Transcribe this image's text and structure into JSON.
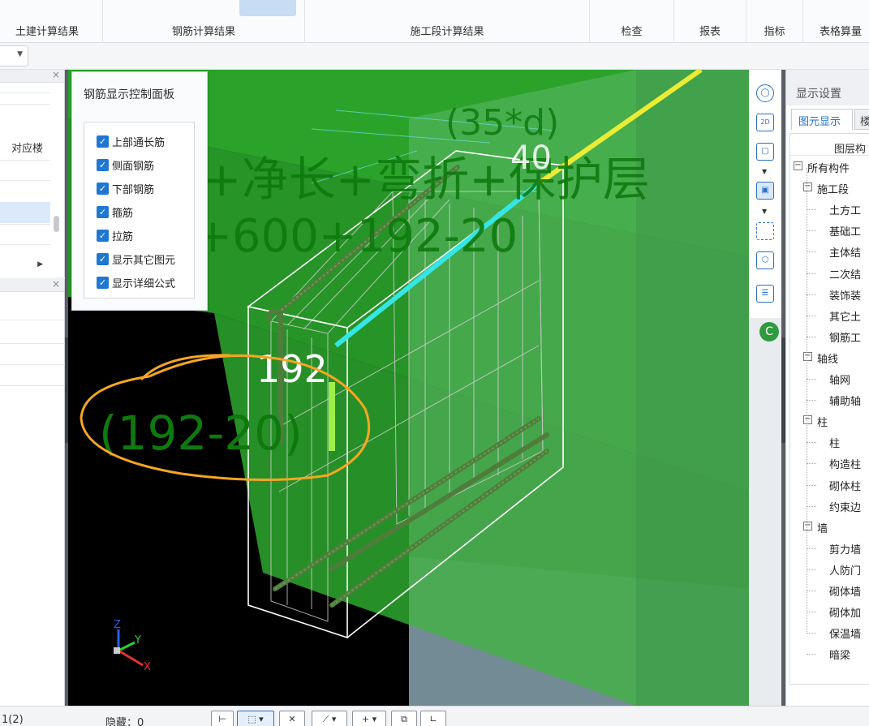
{
  "ribbon": {
    "groups": [
      "土建计算结果",
      "钢筋计算结果",
      "施工段计算结果",
      "检查",
      "报表",
      "指标",
      "表格算量"
    ]
  },
  "left_panel": {
    "column_header": "对应楼",
    "close_glyph": "×"
  },
  "rebar_panel": {
    "title": "钢筋显示控制面板",
    "options": [
      {
        "label": "上部通长筋",
        "checked": true
      },
      {
        "label": "侧面钢筋",
        "checked": true
      },
      {
        "label": "下部钢筋",
        "checked": true
      },
      {
        "label": "箍筋",
        "checked": true
      },
      {
        "label": "拉筋",
        "checked": true
      },
      {
        "label": "显示其它图元",
        "checked": true
      },
      {
        "label": "显示详细公式",
        "checked": true
      }
    ]
  },
  "viewport": {
    "overlay_formula_line1": "+净长+弯折+保护层",
    "overlay_formula_line2": "+600+192-20",
    "overlay_35d": "(35*d)",
    "overlay_40": "40",
    "dim_192": "192",
    "annotation_handwritten": "(192-20)",
    "axis_z": "Z",
    "axis_y": "Y",
    "axis_x": "X"
  },
  "tool_strip": {
    "icons": [
      "orbit-icon",
      "2d-view-icon",
      "3d-box-icon",
      "3d-box-solid-icon",
      "fit-view-icon",
      "cube-select-icon",
      "layer-list-icon"
    ],
    "label_2d": "2D",
    "c_button": "C"
  },
  "right_panel": {
    "title": "显示设置",
    "tab_active": "图元显示",
    "tab_other": "楼",
    "column_header": "图层构",
    "tree": [
      {
        "level": 0,
        "label": "所有构件",
        "expander": "−"
      },
      {
        "level": 1,
        "label": "施工段",
        "expander": "−"
      },
      {
        "level": 2,
        "label": "土方工"
      },
      {
        "level": 2,
        "label": "基础工"
      },
      {
        "level": 2,
        "label": "主体结"
      },
      {
        "level": 2,
        "label": "二次结"
      },
      {
        "level": 2,
        "label": "装饰装"
      },
      {
        "level": 2,
        "label": "其它土"
      },
      {
        "level": 2,
        "label": "钢筋工"
      },
      {
        "level": 1,
        "label": "轴线",
        "expander": "−"
      },
      {
        "level": 2,
        "label": "轴网"
      },
      {
        "level": 2,
        "label": "辅助轴"
      },
      {
        "level": 1,
        "label": "柱",
        "expander": "−"
      },
      {
        "level": 2,
        "label": "柱"
      },
      {
        "level": 2,
        "label": "构造柱"
      },
      {
        "level": 2,
        "label": "砌体柱"
      },
      {
        "level": 2,
        "label": "约束边"
      },
      {
        "level": 1,
        "label": "墙",
        "expander": "−"
      },
      {
        "level": 2,
        "label": "剪力墙"
      },
      {
        "level": 2,
        "label": "人防门"
      },
      {
        "level": 2,
        "label": "砌体墙"
      },
      {
        "level": 2,
        "label": "砌体加"
      },
      {
        "level": 2,
        "label": "保温墙"
      },
      {
        "level": 2,
        "label": "暗梁"
      }
    ]
  },
  "statusbar": {
    "page": "1(2)",
    "hidden_label": "隐藏：0"
  },
  "colors": {
    "accent": "#1f77d4",
    "green_overlay": "#1f9e1f",
    "annotation_orange": "#f5a623",
    "purple": "#8a3fd1"
  }
}
